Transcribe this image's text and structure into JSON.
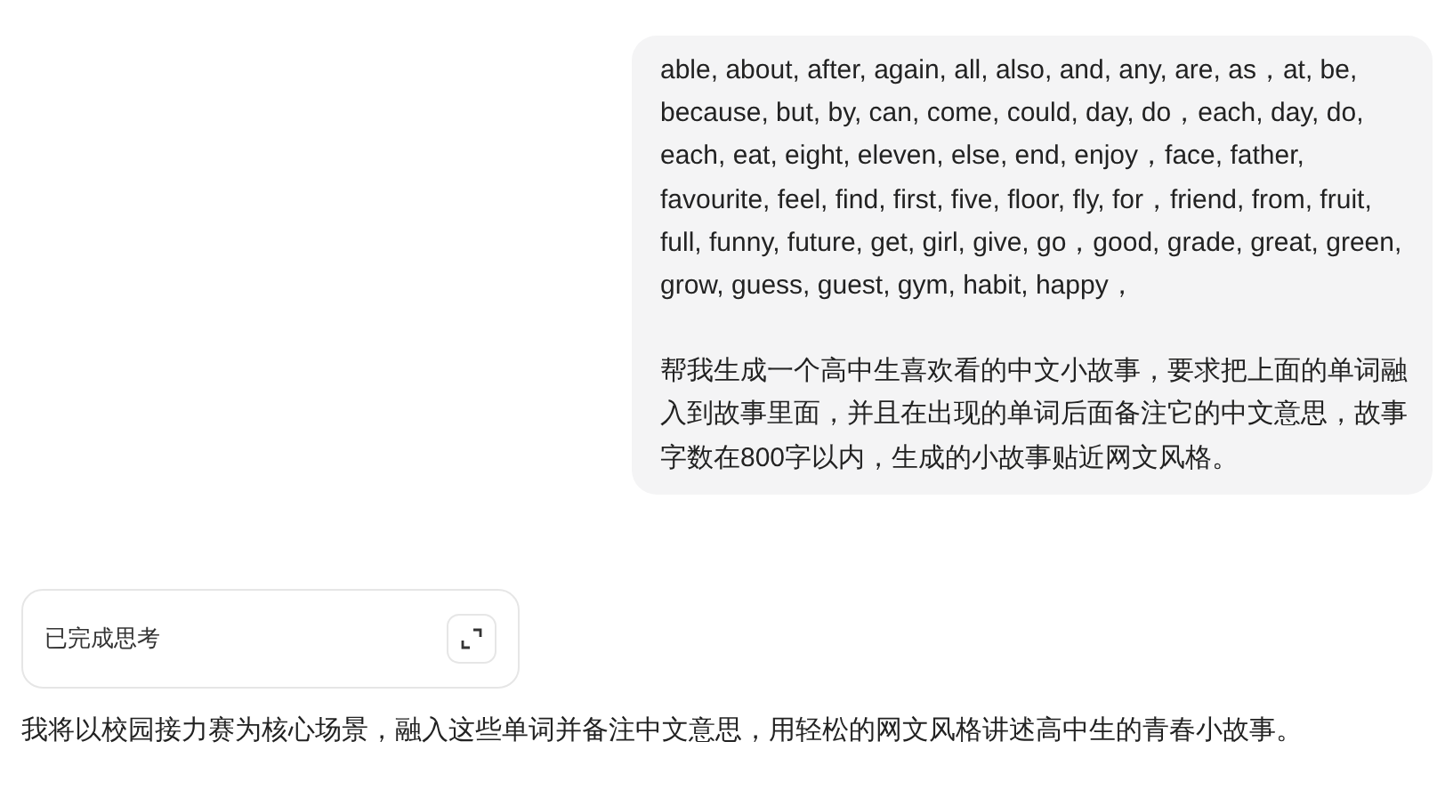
{
  "user_message": {
    "paragraphs": [
      "able, about, after, again, all, also, and, any, are, as，at, be, because, but, by, can, come, could, day, do，each, day, do, each, eat, eight, eleven, else, end, enjoy，face, father, favourite, feel, find, first, five, floor, fly, for，friend, from, fruit, full, funny, future, get, girl, give, go，good, grade, great, green, grow, guess, guest, gym, habit, happy，",
      "帮我生成一个高中生喜欢看的中文小故事，要求把上面的单词融入到故事里面，并且在出现的单词后面备注它的中文意思，故事字数在800字以内，生成的小故事贴近网文风格。"
    ]
  },
  "thinking": {
    "label": "已完成思考",
    "expanded": false
  },
  "reply": "我将以校园接力赛为核心场景，融入这些单词并备注中文意思，用轻松的网文风格讲述高中生的青春小故事。"
}
